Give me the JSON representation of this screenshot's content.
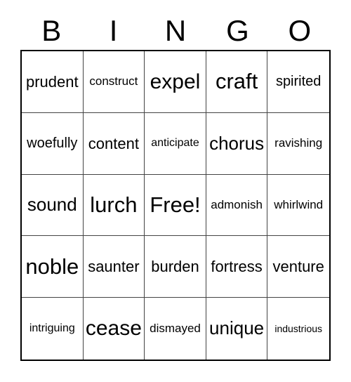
{
  "card": {
    "title": "BINGO",
    "header_letters": [
      "B",
      "I",
      "N",
      "G",
      "O"
    ],
    "free_space_label": "Free!",
    "colors": {
      "background": "#ffffff",
      "text": "#000000",
      "outer_border": "#000000",
      "grid_line": "#444444"
    },
    "grid": {
      "columns": 5,
      "rows": 5,
      "cells": [
        [
          {
            "text": "prudent",
            "size": "len-7"
          },
          {
            "text": "construct",
            "size": "len-9"
          },
          {
            "text": "expel",
            "size": "len-5"
          },
          {
            "text": "craft",
            "size": "len-4"
          },
          {
            "text": "spirited",
            "size": "len-8"
          }
        ],
        [
          {
            "text": "woefully",
            "size": "len-8"
          },
          {
            "text": "content",
            "size": "len-7"
          },
          {
            "text": "anticipate",
            "size": "len-10"
          },
          {
            "text": "chorus",
            "size": "len-6"
          },
          {
            "text": "ravishing",
            "size": "len-9"
          }
        ],
        [
          {
            "text": "sound",
            "size": "len-6"
          },
          {
            "text": "lurch",
            "size": "len-4"
          },
          {
            "text": "Free!",
            "size": "len-4"
          },
          {
            "text": "admonish",
            "size": "len-9"
          },
          {
            "text": "whirlwind",
            "size": "len-9"
          }
        ],
        [
          {
            "text": "noble",
            "size": "len-4"
          },
          {
            "text": "saunter",
            "size": "len-7"
          },
          {
            "text": "burden",
            "size": "len-7"
          },
          {
            "text": "fortress",
            "size": "len-7"
          },
          {
            "text": "venture",
            "size": "len-7"
          }
        ],
        [
          {
            "text": "intriguing",
            "size": "len-10"
          },
          {
            "text": "cease",
            "size": "len-5"
          },
          {
            "text": "dismayed",
            "size": "len-9"
          },
          {
            "text": "unique",
            "size": "len-6"
          },
          {
            "text": "industrious",
            "size": "len-11"
          }
        ]
      ]
    }
  }
}
